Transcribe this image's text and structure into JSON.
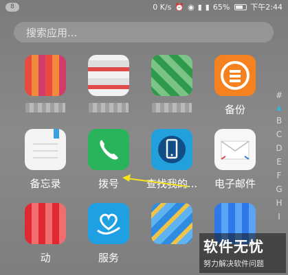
{
  "status_bar": {
    "notification_count": "8",
    "net_speed": "0 K/s",
    "battery": "65%",
    "time": "下午2:44",
    "icons": [
      "alarm-icon",
      "eye-icon",
      "signal-icon",
      "lte-signal-icon",
      "battery-icon"
    ]
  },
  "search": {
    "placeholder": "搜索应用..."
  },
  "apps": {
    "backup": {
      "label": "备份",
      "icon": "backup-icon",
      "color": "#f5821f"
    },
    "memo": {
      "label": "备忘录",
      "icon": "memo-icon",
      "color": "#f4f4f4"
    },
    "dialer": {
      "label": "拨号",
      "icon": "phone-icon",
      "color": "#29b35a"
    },
    "find_phone": {
      "label": "查找我的...",
      "icon": "find-phone-icon",
      "color": "#21a0dc"
    },
    "email": {
      "label": "电子邮件",
      "icon": "mail-icon",
      "color": "#f7f7f7"
    },
    "services": {
      "label": "服务",
      "icon": "heart-hand-icon",
      "color": "#1ea0e3"
    },
    "partial_label": {
      "label": "动"
    }
  },
  "index_bar": [
    "#",
    "▲",
    "B",
    "C",
    "D",
    "E",
    "F",
    "G",
    "H",
    "I"
  ],
  "watermark": {
    "title": "软件无忧",
    "subtitle": "努力解决软件问题"
  }
}
